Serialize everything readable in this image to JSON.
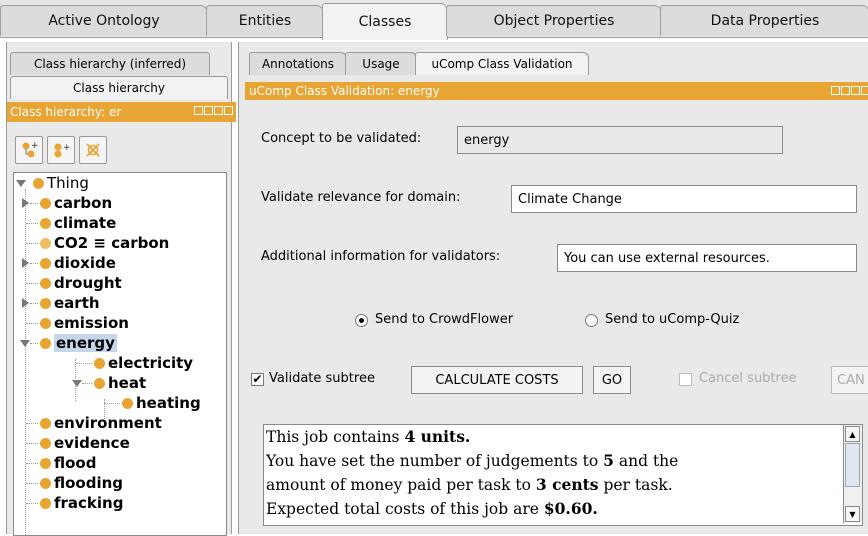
{
  "top_tabs": [
    "Active Ontology",
    "Entities",
    "Classes",
    "Object Properties",
    "Data Properties"
  ],
  "left": {
    "tabs": [
      "Class hierarchy (inferred)",
      "Class hierarchy"
    ],
    "title": "Class hierarchy: er",
    "tree": {
      "root": "Thing",
      "items": [
        "carbon",
        "climate",
        "CO2 ≡ carbon",
        "dioxide",
        "drought",
        "earth",
        "emission",
        "energy",
        "electricity",
        "heat",
        "heating",
        "environment",
        "evidence",
        "flood",
        "flooding",
        "fracking"
      ]
    }
  },
  "right": {
    "tabs": [
      "Annotations",
      "Usage",
      "uComp Class Validation"
    ],
    "title": "uComp Class Validation: energy",
    "concept_label": "Concept to be validated:",
    "concept_value": "energy",
    "domain_label": "Validate relevance for domain:",
    "domain_value": "Climate Change",
    "info_label": "Additional information for validators:",
    "info_value": "You can use external resources.",
    "radio_crowdflower": "Send to CrowdFlower",
    "radio_quiz": "Send to uComp-Quiz",
    "validate_subtree": "Validate subtree",
    "calc_costs": "CALCULATE COSTS",
    "go": "GO",
    "cancel_subtree": "Cancel subtree",
    "can_btn": "CAN",
    "cost": {
      "l1a": "This job contains ",
      "l1b": "4 units.",
      "l2a": "You have set the number of judgements to ",
      "l2b": "5",
      "l2c": " and the",
      "l3a": "amount of money paid per task to ",
      "l3b": "3 cents",
      "l3c": " per task.",
      "l4a": "Expected total costs of this job are ",
      "l4b": "$0.60."
    }
  }
}
